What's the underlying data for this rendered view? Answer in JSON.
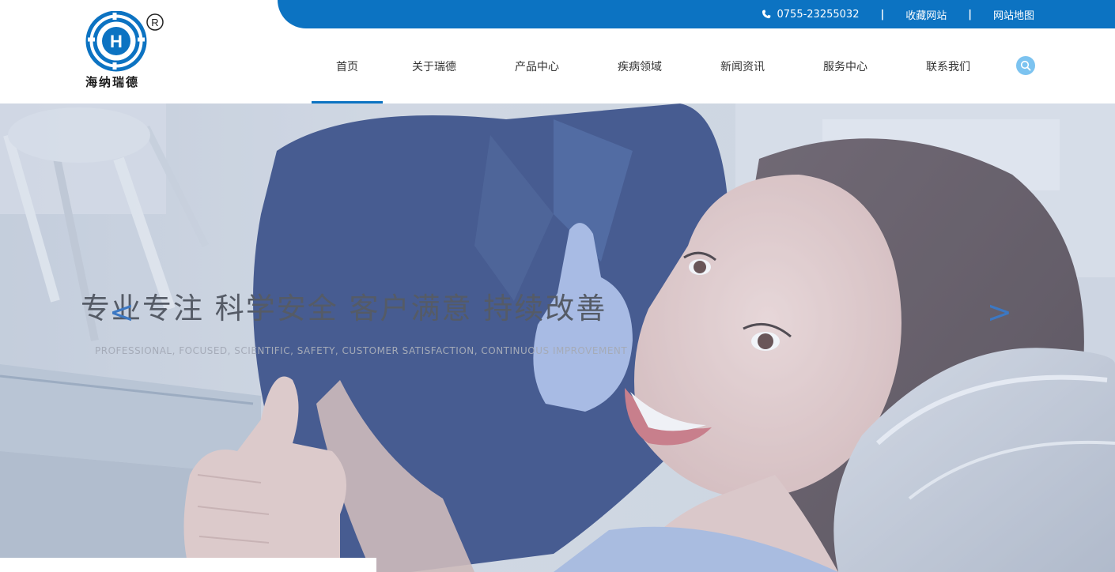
{
  "topbar": {
    "phone": "0755-23255032",
    "separator": "|",
    "bookmark": "收藏网站",
    "sitemap": "网站地图"
  },
  "logo": {
    "letter": "H",
    "registered": "R",
    "name": "海纳瑞德"
  },
  "nav": {
    "items": [
      "首页",
      "关于瑞德",
      "产品中心",
      "疾病领域",
      "新闻资讯",
      "服务中心",
      "联系我们"
    ],
    "active_index": 0
  },
  "banner": {
    "slogan": "专业专注  科学安全  客户满意  持续改善",
    "subtitle": "PROFESSIONAL, FOCUSED, SCIENTIFIC, SAFETY, CUSTOMER SATISFACTION, CONTINUOUS IMPROVEMENT",
    "prev": "<",
    "next": ">"
  },
  "colors": {
    "brand_blue": "#0c73c2",
    "search_blue": "#7cc3f0"
  }
}
